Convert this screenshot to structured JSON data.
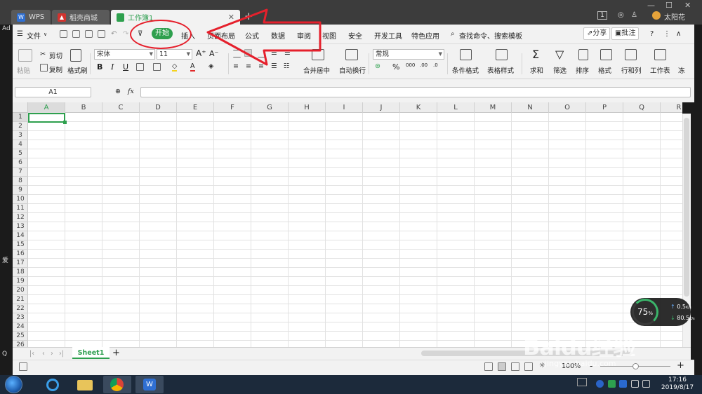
{
  "window": {
    "tabs": [
      {
        "label": "WPS"
      },
      {
        "label": "稻壳商城"
      },
      {
        "label": "工作簿1"
      }
    ],
    "new_tab": "+",
    "badge": "1",
    "user": "太阳花",
    "side_left_top": "Ad",
    "side_left_mid": "爱",
    "side_left_bottom": "Q"
  },
  "menu": {
    "file": "文件",
    "items": [
      "开始",
      "插入",
      "页面布局",
      "公式",
      "数据",
      "审阅",
      "视图",
      "安全",
      "开发工具",
      "特色应用"
    ],
    "search": "查找命令、搜索模板",
    "share": "分享",
    "comment": "批注",
    "help": "?"
  },
  "ribbon": {
    "paste": "粘贴",
    "cut": "剪切",
    "copy": "复制",
    "format_painter": "格式刷",
    "font_name": "宋体",
    "font_size": "11",
    "merge": "合并居中",
    "wrap": "自动换行",
    "number_format": "常规",
    "cond_format": "条件格式",
    "table_style": "表格样式",
    "sum": "求和",
    "filter": "筛选",
    "sort": "排序",
    "format": "格式",
    "rowcol": "行和列",
    "worksheet": "工作表",
    "freeze": "冻",
    "bold": "B",
    "italic": "I",
    "underline": "U",
    "percent": "%",
    "thousands": "000",
    "dec_inc": ".00",
    "dec_dec": ".0"
  },
  "formula": {
    "cell_ref": "A1",
    "fx": "fx",
    "value": ""
  },
  "grid": {
    "columns": [
      "A",
      "B",
      "C",
      "D",
      "E",
      "F",
      "G",
      "H",
      "I",
      "J",
      "K",
      "L",
      "M",
      "N",
      "O",
      "P",
      "Q",
      "R"
    ],
    "rows": [
      "1",
      "2",
      "3",
      "4",
      "5",
      "6",
      "7",
      "8",
      "9",
      "10",
      "11",
      "12",
      "13",
      "14",
      "15",
      "16",
      "17",
      "18",
      "19",
      "20",
      "21",
      "22",
      "23",
      "24",
      "25",
      "26"
    ],
    "active_cell": "A1"
  },
  "sheets": {
    "tabs": [
      "Sheet1"
    ],
    "add": "+"
  },
  "status": {
    "zoom": "100%",
    "zoom_minus": "-",
    "zoom_plus": "+"
  },
  "speed": {
    "percent": "75",
    "unit": "%",
    "up": "0.5",
    "down": "80.5",
    "rate_unit": "K/s"
  },
  "taskbar": {
    "time": "17:16",
    "date": "2019/8/17"
  },
  "watermark": {
    "text": "Baidu经验",
    "url": "jingyan.baidu.com"
  },
  "colors": {
    "accent": "#2ea04e",
    "annotation": "#e5202c"
  }
}
